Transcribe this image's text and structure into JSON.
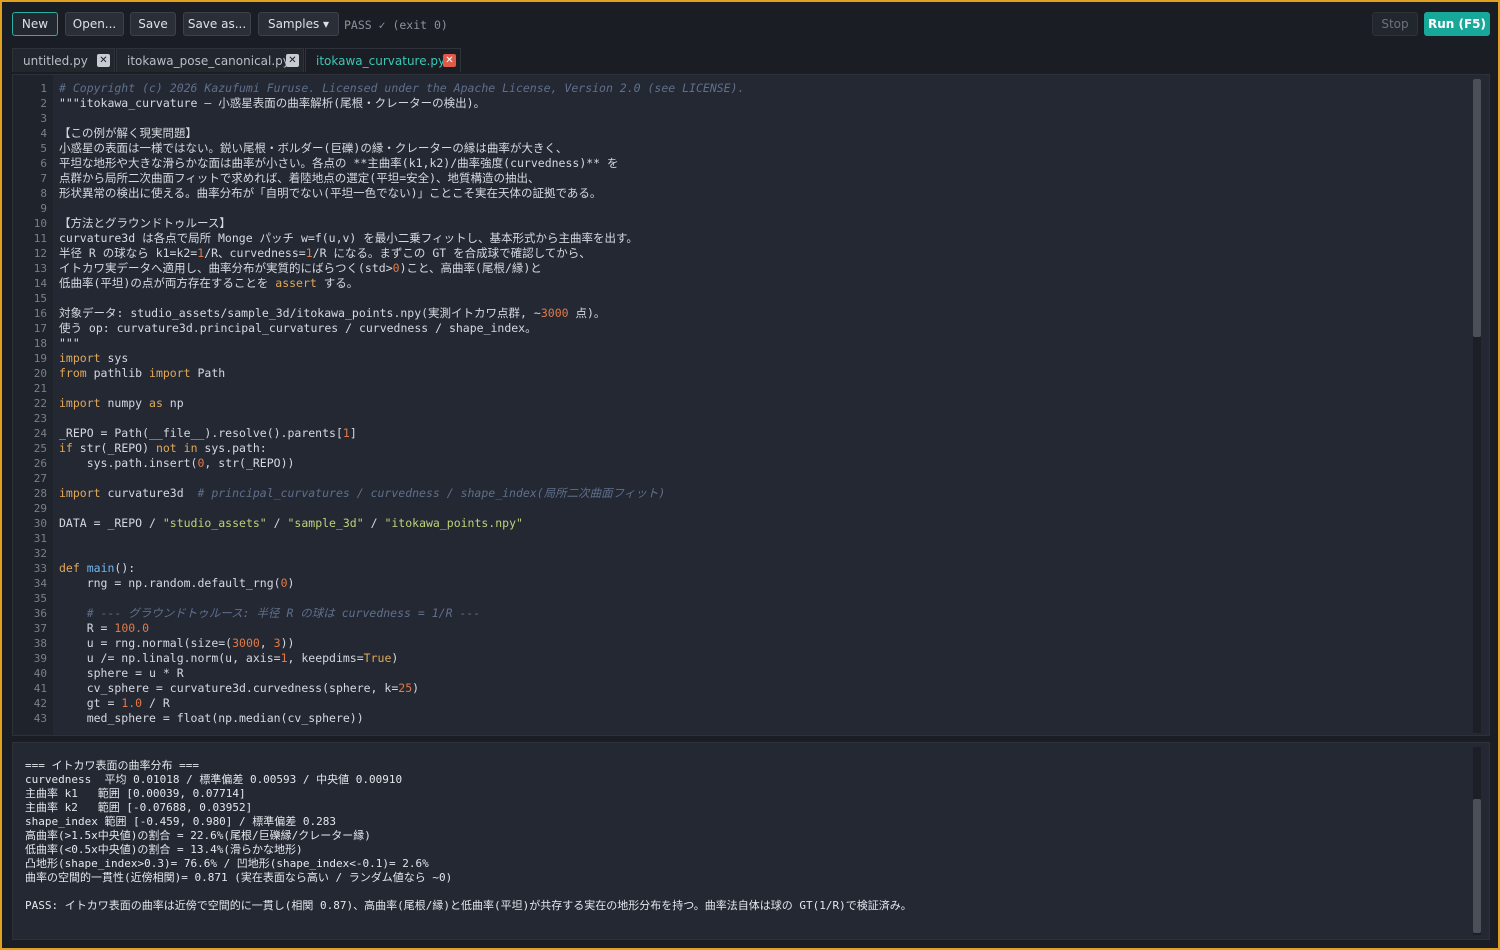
{
  "toolbar": {
    "new_label": "New",
    "open_label": "Open...",
    "save_label": "Save",
    "save_as_label": "Save as...",
    "samples_label": "Samples ▾",
    "stop_label": "Stop",
    "run_label": "Run (F5)"
  },
  "status_text": "PASS ✓ (exit 0)",
  "tabs": [
    {
      "label": "untitled.py"
    },
    {
      "label": "itokawa_pose_canonical.py"
    },
    {
      "label": "itokawa_curvature.py"
    }
  ],
  "editor": {
    "line_numbers": [
      "1",
      "2",
      "3",
      "4",
      "5",
      "6",
      "7",
      "8",
      "9",
      "10",
      "11",
      "12",
      "13",
      "14",
      "15",
      "16",
      "17",
      "18",
      "19",
      "20",
      "21",
      "22",
      "23",
      "24",
      "25",
      "26",
      "27",
      "28",
      "29",
      "30",
      "31",
      "32",
      "33",
      "34",
      "35",
      "36",
      "37",
      "38",
      "39",
      "40",
      "41",
      "42",
      "43"
    ],
    "lines": [
      [
        {
          "t": "# Copyright (c) 2026 Kazufumi Furuse. Licensed under the Apache License, Version 2.0 (see LICENSE).",
          "c": "c"
        }
      ],
      [
        {
          "t": "\"\"\"itokawa_curvature — 小惑星表面の曲率解析(尾根・クレーターの検出)。"
        }
      ],
      [
        {
          "t": ""
        }
      ],
      [
        {
          "t": "【この例が解く現実問題】"
        }
      ],
      [
        {
          "t": "小惑星の表面は一様ではない。鋭い尾根・ボルダー(巨礫)の縁・クレーターの縁は曲率が大きく、"
        }
      ],
      [
        {
          "t": "平坦な地形や大きな滑らかな面は曲率が小さい。各点の **主曲率(k1,k2)/曲率強度(curvedness)** を"
        }
      ],
      [
        {
          "t": "点群から局所二次曲面フィットで求めれば、着陸地点の選定(平坦=安全)、地質構造の抽出、"
        }
      ],
      [
        {
          "t": "形状異常の検出に使える。曲率分布が「自明でない(平坦一色でない)」ことこそ実在天体の証拠である。"
        }
      ],
      [
        {
          "t": ""
        }
      ],
      [
        {
          "t": "【方法とグラウンドトゥルース】"
        }
      ],
      [
        {
          "t": "curvature3d は各点で局所 Monge パッチ w=f(u,v) を最小二乗フィットし、基本形式から主曲率を出す。"
        }
      ],
      [
        {
          "t": "半径 R の球なら k1=k2="
        },
        {
          "t": "1",
          "c": "n"
        },
        {
          "t": "/R、curvedness="
        },
        {
          "t": "1",
          "c": "n"
        },
        {
          "t": "/R になる。まずこの GT を合成球で確認してから、"
        }
      ],
      [
        {
          "t": "イトカワ実データへ適用し、曲率分布が実質的にばらつく(std>"
        },
        {
          "t": "0",
          "c": "n"
        },
        {
          "t": ")こと、高曲率(尾根/縁)と"
        }
      ],
      [
        {
          "t": "低曲率(平坦)の点が両方存在することを "
        },
        {
          "t": "assert",
          "c": "k"
        },
        {
          "t": " する。"
        }
      ],
      [
        {
          "t": ""
        }
      ],
      [
        {
          "t": "対象データ: studio_assets/sample_3d/itokawa_points.npy(実測イトカワ点群, ~"
        },
        {
          "t": "3000",
          "c": "n"
        },
        {
          "t": " 点)。"
        }
      ],
      [
        {
          "t": "使う op: curvature3d.principal_curvatures / curvedness / shape_index。"
        }
      ],
      [
        {
          "t": "\"\"\""
        }
      ],
      [
        {
          "t": "import",
          "c": "k"
        },
        {
          "t": " sys"
        }
      ],
      [
        {
          "t": "from",
          "c": "k"
        },
        {
          "t": " pathlib "
        },
        {
          "t": "import",
          "c": "k"
        },
        {
          "t": " Path"
        }
      ],
      [
        {
          "t": ""
        }
      ],
      [
        {
          "t": "import",
          "c": "k"
        },
        {
          "t": " numpy "
        },
        {
          "t": "as",
          "c": "k"
        },
        {
          "t": " np"
        }
      ],
      [
        {
          "t": ""
        }
      ],
      [
        {
          "t": "_REPO = Path(__file__).resolve().parents["
        },
        {
          "t": "1",
          "c": "n"
        },
        {
          "t": "]"
        }
      ],
      [
        {
          "t": "if",
          "c": "k"
        },
        {
          "t": " str(_REPO) "
        },
        {
          "t": "not in",
          "c": "k"
        },
        {
          "t": " sys.path:"
        }
      ],
      [
        {
          "t": "    sys.path.insert("
        },
        {
          "t": "0",
          "c": "n"
        },
        {
          "t": ", str(_REPO))"
        }
      ],
      [
        {
          "t": ""
        }
      ],
      [
        {
          "t": "import",
          "c": "k"
        },
        {
          "t": " curvature3d  "
        },
        {
          "t": "# principal_curvatures / curvedness / shape_index(局所二次曲面フィット)",
          "c": "c"
        }
      ],
      [
        {
          "t": ""
        }
      ],
      [
        {
          "t": "DATA = _REPO / "
        },
        {
          "t": "\"studio_assets\"",
          "c": "s"
        },
        {
          "t": " / "
        },
        {
          "t": "\"sample_3d\"",
          "c": "s"
        },
        {
          "t": " / "
        },
        {
          "t": "\"itokawa_points.npy\"",
          "c": "s"
        }
      ],
      [
        {
          "t": ""
        }
      ],
      [
        {
          "t": ""
        }
      ],
      [
        {
          "t": "def",
          "c": "k"
        },
        {
          "t": " "
        },
        {
          "t": "main",
          "c": "f"
        },
        {
          "t": "():"
        }
      ],
      [
        {
          "t": "    rng = np.random.default_rng("
        },
        {
          "t": "0",
          "c": "n"
        },
        {
          "t": ")"
        }
      ],
      [
        {
          "t": ""
        }
      ],
      [
        {
          "t": "    "
        },
        {
          "t": "# --- グラウンドトゥルース: 半径 R の球は curvedness = 1/R ---",
          "c": "c"
        }
      ],
      [
        {
          "t": "    R = "
        },
        {
          "t": "100.0",
          "c": "n"
        }
      ],
      [
        {
          "t": "    u = rng.normal(size=("
        },
        {
          "t": "3000",
          "c": "n"
        },
        {
          "t": ", "
        },
        {
          "t": "3",
          "c": "n"
        },
        {
          "t": "))"
        }
      ],
      [
        {
          "t": "    u /= np.linalg.norm(u, axis="
        },
        {
          "t": "1",
          "c": "n"
        },
        {
          "t": ", keepdims="
        },
        {
          "t": "True",
          "c": "k"
        },
        {
          "t": ")"
        }
      ],
      [
        {
          "t": "    sphere = u * R"
        }
      ],
      [
        {
          "t": "    cv_sphere = curvature3d.curvedness(sphere, k="
        },
        {
          "t": "25",
          "c": "n"
        },
        {
          "t": ")"
        }
      ],
      [
        {
          "t": "    gt = "
        },
        {
          "t": "1.0",
          "c": "n"
        },
        {
          "t": " / R"
        }
      ],
      [
        {
          "t": "    med_sphere = float(np.median(cv_sphere))"
        }
      ]
    ]
  },
  "output": {
    "lines": [
      "=== イトカワ表面の曲率分布 ===",
      "curvedness  平均 0.01018 / 標準偏差 0.00593 / 中央値 0.00910",
      "主曲率 k1   範囲 [0.00039, 0.07714]",
      "主曲率 k2   範囲 [-0.07688, 0.03952]",
      "shape_index 範囲 [-0.459, 0.980] / 標準偏差 0.283",
      "高曲率(>1.5x中央値)の割合 = 22.6%(尾根/巨礫縁/クレーター縁)",
      "低曲率(<0.5x中央値)の割合 = 13.4%(滑らかな地形)",
      "凸地形(shape_index>0.3)= 76.6% / 凹地形(shape_index<-0.1)= 2.6%",
      "曲率の空間的一貫性(近傍相関)= 0.871 (実在表面なら高い / ランダム値なら ~0)",
      "",
      "PASS: イトカワ表面の曲率は近傍で空間的に一貫し(相関 0.87)、高曲率(尾根/縁)と低曲率(平坦)が共存する実在の地形分布を持つ。曲率法自体は球の GT(1/R)で検証済み。"
    ]
  },
  "colors": {
    "accent": "#17a89a",
    "active_tab_text": "#3cc7b6",
    "tab_close_active": "#e05a4a",
    "window_border": "#e0a020"
  }
}
